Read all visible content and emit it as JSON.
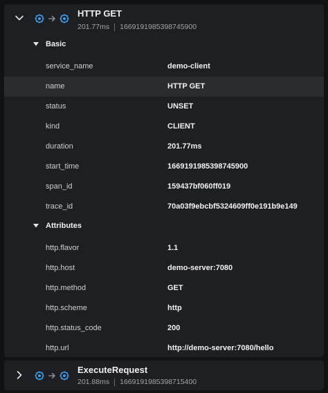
{
  "spans": [
    {
      "expanded": true,
      "name": "HTTP GET",
      "duration": "201.77ms",
      "start": "1669191985398745900",
      "icons": [
        "service-icon",
        "arrow-right-icon",
        "service-icon"
      ],
      "sections": [
        {
          "label": "Basic",
          "rows": [
            {
              "key": "service_name",
              "value": "demo-client"
            },
            {
              "key": "name",
              "value": "HTTP GET"
            },
            {
              "key": "status",
              "value": "UNSET"
            },
            {
              "key": "kind",
              "value": "CLIENT"
            },
            {
              "key": "duration",
              "value": "201.77ms"
            },
            {
              "key": "start_time",
              "value": "1669191985398745900"
            },
            {
              "key": "span_id",
              "value": "159437bf060ff019"
            },
            {
              "key": "trace_id",
              "value": "70a03f9ebcbf5324609ff0e191b9e149"
            }
          ]
        },
        {
          "label": "Attributes",
          "rows": [
            {
              "key": "http.flavor",
              "value": "1.1"
            },
            {
              "key": "http.host",
              "value": "demo-server:7080"
            },
            {
              "key": "http.method",
              "value": "GET"
            },
            {
              "key": "http.scheme",
              "value": "http"
            },
            {
              "key": "http.status_code",
              "value": "200"
            },
            {
              "key": "http.url",
              "value": "http://demo-server:7080/hello"
            }
          ]
        }
      ]
    },
    {
      "expanded": false,
      "name": "ExecuteRequest",
      "duration": "201.88ms",
      "start": "1669191985398715400",
      "icons": [
        "service-icon",
        "arrow-right-icon",
        "service-icon"
      ]
    }
  ],
  "colors": {
    "background": "#111214",
    "card": "#1e1f22",
    "highlight_row": "#2b2c30",
    "service_icon": "#3d9be9",
    "text_primary": "#f0f0f2",
    "text_secondary": "#a4a6ab"
  }
}
